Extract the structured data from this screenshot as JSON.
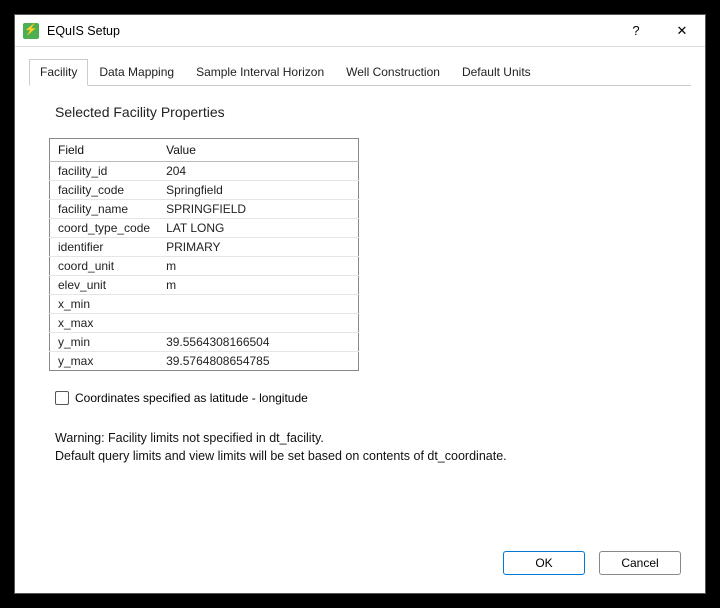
{
  "window": {
    "title": "EQuIS Setup"
  },
  "tabs": [
    "Facility",
    "Data Mapping",
    "Sample Interval Horizon",
    "Well Construction",
    "Default Units"
  ],
  "section_title": "Selected Facility Properties",
  "table": {
    "headers": {
      "field": "Field",
      "value": "Value"
    },
    "rows": [
      {
        "field": "facility_id",
        "value": "204"
      },
      {
        "field": "facility_code",
        "value": "Springfield"
      },
      {
        "field": "facility_name",
        "value": "SPRINGFIELD"
      },
      {
        "field": "coord_type_code",
        "value": "LAT LONG"
      },
      {
        "field": "identifier",
        "value": "PRIMARY"
      },
      {
        "field": "coord_unit",
        "value": "m"
      },
      {
        "field": "elev_unit",
        "value": "m"
      },
      {
        "field": "x_min",
        "value": ""
      },
      {
        "field": "x_max",
        "value": ""
      },
      {
        "field": "y_min",
        "value": "39.5564308166504"
      },
      {
        "field": "y_max",
        "value": "39.5764808654785"
      }
    ]
  },
  "checkbox_label": "Coordinates specified as latitude - longitude",
  "warning_line1": "Warning: Facility limits not specified in dt_facility.",
  "warning_line2": "Default query limits and view limits will be set based on contents of dt_coordinate.",
  "buttons": {
    "ok": "OK",
    "cancel": "Cancel"
  },
  "titlebar": {
    "help": "?",
    "close": "✕"
  }
}
